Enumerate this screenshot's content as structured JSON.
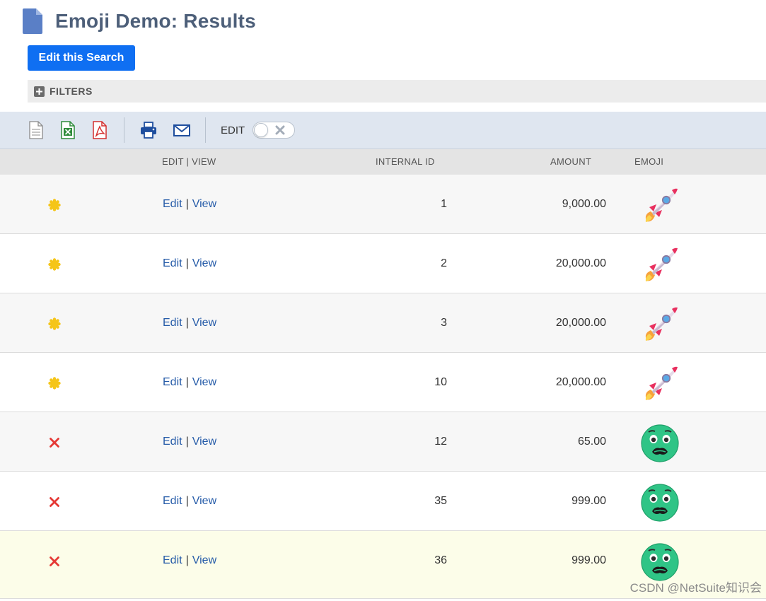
{
  "page": {
    "title": "Emoji Demo: Results",
    "edit_search_label": "Edit this Search",
    "filters_label": "FILTERS"
  },
  "toolbar": {
    "icons": [
      "document-icon",
      "excel-icon",
      "pdf-icon",
      "print-icon",
      "email-icon"
    ],
    "edit_label": "EDIT",
    "edit_toggle_on": false
  },
  "table": {
    "columns": [
      "EDIT | VIEW",
      "INTERNAL ID",
      "AMOUNT",
      "EMOJI"
    ],
    "link_edit": "Edit",
    "link_separator": "|",
    "link_view": "View",
    "rows": [
      {
        "status": "yellow-dot-icon",
        "internal_id": "1",
        "amount": "9,000.00",
        "emoji": "rocket-emoji"
      },
      {
        "status": "yellow-dot-icon",
        "internal_id": "2",
        "amount": "20,000.00",
        "emoji": "rocket-emoji"
      },
      {
        "status": "yellow-dot-icon",
        "internal_id": "3",
        "amount": "20,000.00",
        "emoji": "rocket-emoji"
      },
      {
        "status": "yellow-dot-icon",
        "internal_id": "10",
        "amount": "20,000.00",
        "emoji": "rocket-emoji"
      },
      {
        "status": "red-x-icon",
        "internal_id": "12",
        "amount": "65.00",
        "emoji": "nauseated-face-emoji"
      },
      {
        "status": "red-x-icon",
        "internal_id": "35",
        "amount": "999.00",
        "emoji": "nauseated-face-emoji"
      },
      {
        "status": "red-x-icon",
        "internal_id": "36",
        "amount": "999.00",
        "emoji": "nauseated-face-emoji"
      }
    ]
  },
  "colors": {
    "title": "#4d5f79",
    "button": "#0f6ff2",
    "link": "#255ba8",
    "status_yellow": "#f5c518",
    "status_red": "#e53935"
  },
  "watermark": "CSDN @NetSuite知识会"
}
